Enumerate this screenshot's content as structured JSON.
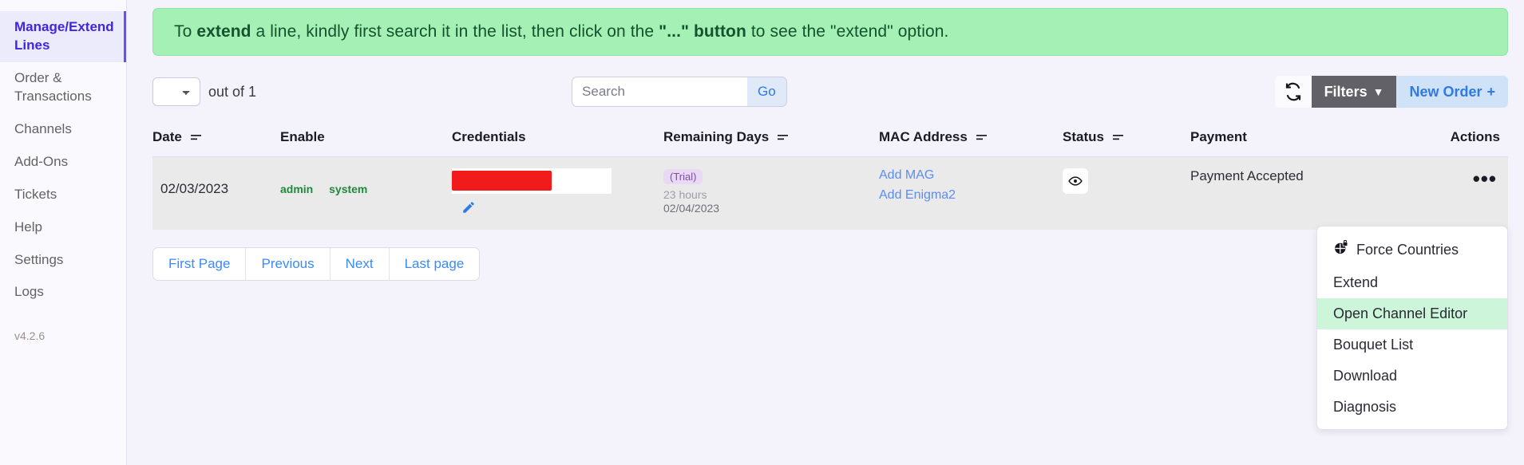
{
  "sidebar": {
    "items": [
      {
        "label": "Manage/Extend Lines",
        "active": true
      },
      {
        "label": "Order & Transactions",
        "active": false
      },
      {
        "label": "Channels",
        "active": false
      },
      {
        "label": "Add-Ons",
        "active": false
      },
      {
        "label": "Tickets",
        "active": false
      },
      {
        "label": "Help",
        "active": false
      },
      {
        "label": "Settings",
        "active": false
      },
      {
        "label": "Logs",
        "active": false
      }
    ],
    "version": "v4.2.6"
  },
  "alert": {
    "part1": "To ",
    "bold1": "extend",
    "part2": " a line, kindly first search it in the list, then click on the ",
    "bold2": "\"...\" button",
    "part3": " to see the \"extend\" option."
  },
  "toolbar": {
    "page_value": "",
    "out_of": "out of 1",
    "search_value": "",
    "search_placeholder": "Search",
    "go_label": "Go",
    "refresh_icon": "refresh-icon",
    "filters_label": "Filters",
    "filters_caret": "▼",
    "new_order_label": "New Order",
    "new_order_plus": "+"
  },
  "table": {
    "headers": [
      {
        "label": "Date",
        "sortable": true
      },
      {
        "label": "Enable",
        "sortable": false
      },
      {
        "label": "Credentials",
        "sortable": false
      },
      {
        "label": "Remaining Days",
        "sortable": true
      },
      {
        "label": "MAC Address",
        "sortable": true
      },
      {
        "label": "Status",
        "sortable": true
      },
      {
        "label": "Payment",
        "sortable": false
      },
      {
        "label": "Actions",
        "sortable": false
      }
    ],
    "rows": [
      {
        "date": "02/03/2023",
        "enable_admin": "admin",
        "enable_system": "system",
        "credentials_redacted": true,
        "edit_icon": "pencil-icon",
        "trial_badge": "(Trial)",
        "remaining_hours": "23 hours",
        "remaining_date": "02/04/2023",
        "mac_link1": "Add MAG",
        "mac_link2": "Add Enigma2",
        "status_icon": "eye-icon",
        "payment": "Payment Accepted",
        "actions": "•••"
      }
    ]
  },
  "pagination": {
    "buttons": [
      "First Page",
      "Previous",
      "Next",
      "Last page"
    ]
  },
  "dropdown": {
    "items": [
      {
        "label": "Force Countries",
        "icon": "globe-lock-icon",
        "highlight": false
      },
      {
        "label": "Extend",
        "icon": "",
        "highlight": false
      },
      {
        "label": "Open Channel Editor",
        "icon": "",
        "highlight": true
      },
      {
        "label": "Bouquet List",
        "icon": "",
        "highlight": false
      },
      {
        "label": "Download",
        "icon": "",
        "highlight": false
      },
      {
        "label": "Diagnosis",
        "icon": "",
        "highlight": false
      }
    ]
  },
  "colors": {
    "accent": "#4026e0",
    "alert_bg": "#a4f0b5",
    "link": "#3b8af5",
    "filters_bg": "#616167",
    "highlight": "#cdf5d9"
  }
}
